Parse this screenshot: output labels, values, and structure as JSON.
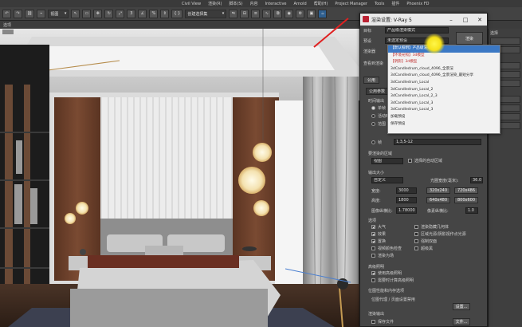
{
  "menubar": {
    "items": [
      "Civil View",
      "渲染(R)",
      "脚本(S)",
      "内容",
      "Interactive",
      "Arnold",
      "帮助(H)",
      "Project Manager",
      "Tools",
      "插件",
      "Phoenix FD"
    ]
  },
  "toolbar": {
    "view_select": "视图",
    "selection_set": "创建选择集",
    "snap_percent": "%"
  },
  "subbar": {
    "label": "选项"
  },
  "dialog": {
    "title": "渲染设置: V-Ray 5",
    "target_label": "目标",
    "target_value": "产品级渲染模式",
    "preset_label": "预设",
    "preset_value": "未选定预设",
    "renderer_label": "渲染器",
    "view_label": "查看到渲染",
    "render_button": "渲染",
    "tab_common": "公用",
    "section_common": "公用参数",
    "time_output": "时间输出",
    "radio_single": "单帧",
    "radio_active": "活动时间段",
    "radio_range": "范围",
    "radio_frames": "帧",
    "frames_value": "1,3,5-12",
    "area_label": "要渲染的区域",
    "area_value": "视图",
    "auto_region": "选择的自动区域",
    "output_size": "输出大小",
    "output_size_value": "自定义",
    "aperture_label": "光圈宽度(毫米):",
    "aperture_value": "36.0",
    "width_label": "宽度:",
    "width_value": "3000",
    "height_label": "高度:",
    "height_value": "1800",
    "res1": "320x240",
    "res2": "720x486",
    "res3": "640x480",
    "res4": "800x600",
    "aspect_label": "图像纵横比:",
    "aspect_value": "1.78000",
    "pixel_aspect_label": "像素纵横比:",
    "pixel_aspect_value": "1.0",
    "options_label": "选项",
    "opt_atmos": "大气",
    "opt_hidden": "渲染隐藏几何体",
    "opt_effects": "效果",
    "opt_area_lights": "区域光源/阴影视作点光源",
    "opt_displace": "置换",
    "opt_force2": "强制双面",
    "opt_video": "视频颜色检查",
    "opt_super": "超级黑",
    "opt_field": "渲染为场",
    "advanced_lighting": "高级照明",
    "use_adv": "使用高级照明",
    "compute_adv": "需要时计算高级照明",
    "bitmap_perf": "位图性能和内存选项",
    "bitmap_proxy": "位图代理 / 页面设置禁用",
    "setup_button": "设置...",
    "render_output": "渲染输出",
    "save_file": "保存文件",
    "file_button": "文件..."
  },
  "dropdown": {
    "items": [
      "【默认照明】产品级渲染",
      "【环境光照】3d模型",
      "【阴影】3d模型",
      "3dCandledrum_cloud_4096_全景渲",
      "3dCandledrum_cloud_4096_全景渲染_最短分享",
      "3dCandledrum_Local",
      "3dCandledrum_Local_2",
      "3dCandledrum_Local_2_3",
      "3dCandledrum_Local_3",
      "3dCandledrum_Local_3",
      "加载预设",
      "保存预设"
    ],
    "selected_index": 0
  },
  "rightpanel": {
    "labels": [
      "选择",
      "修改",
      "参数"
    ]
  },
  "colors": {
    "accent": "#3b78c4",
    "highlight_arrow": "#e02020",
    "cursor_spot": "#f5e11a"
  }
}
